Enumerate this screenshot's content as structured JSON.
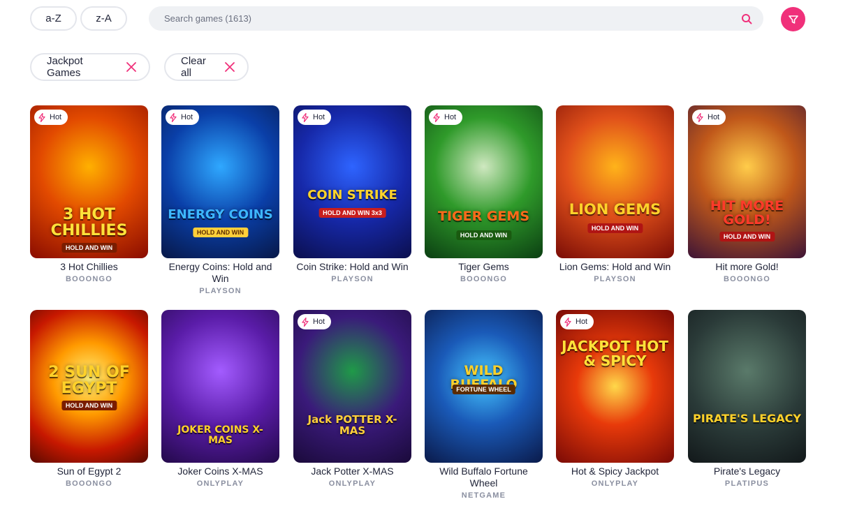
{
  "sort": {
    "az_label": "a-Z",
    "za_label": "z-A"
  },
  "search": {
    "placeholder": "Search games (1613)"
  },
  "filters": {
    "active_chip_label": "Jackpot Games",
    "clear_label": "Clear all"
  },
  "colors": {
    "accent": "#f0307a"
  },
  "hot_label": "Hot",
  "games": [
    {
      "name": "3 Hot Chillies",
      "provider": "BOOONGO",
      "hot": true,
      "art_title": "3 HOT CHILLIES",
      "art_sub": "HOLD AND WIN"
    },
    {
      "name": "Energy Coins: Hold and Win",
      "provider": "PLAYSON",
      "hot": true,
      "art_title": "ENERGY COINS",
      "art_sub": "HOLD AND WIN"
    },
    {
      "name": "Coin Strike: Hold and Win",
      "provider": "PLAYSON",
      "hot": true,
      "art_title": "COIN STRIKE",
      "art_sub": "HOLD AND WIN 3x3"
    },
    {
      "name": "Tiger Gems",
      "provider": "BOOONGO",
      "hot": true,
      "art_title": "TIGER GEMS",
      "art_sub": "HOLD AND WIN"
    },
    {
      "name": "Lion Gems: Hold and Win",
      "provider": "PLAYSON",
      "hot": false,
      "art_title": "LION GEMS",
      "art_sub": "HOLD AND WIN"
    },
    {
      "name": "Hit more Gold!",
      "provider": "BOOONGO",
      "hot": true,
      "art_title": "HIT MORE GOLD!",
      "art_sub": "HOLD AND WIN"
    },
    {
      "name": "Sun of Egypt 2",
      "provider": "BOOONGO",
      "hot": false,
      "art_title": "2 SUN OF EGYPT",
      "art_sub": "HOLD AND WIN"
    },
    {
      "name": "Joker Coins X-MAS",
      "provider": "ONLYPLAY",
      "hot": false,
      "art_title": "JOKER COINS X-MAS",
      "art_sub": ""
    },
    {
      "name": "Jack Potter X-MAS",
      "provider": "ONLYPLAY",
      "hot": true,
      "art_title": "Jack POTTER X-MAS",
      "art_sub": ""
    },
    {
      "name": "Wild Buffalo Fortune Wheel",
      "provider": "NETGAME",
      "hot": false,
      "art_title": "WILD BUFFALO",
      "art_sub": "FORTUNE WHEEL"
    },
    {
      "name": "Hot & Spicy Jackpot",
      "provider": "ONLYPLAY",
      "hot": true,
      "art_title": "JACKPOT HOT & SPICY",
      "art_sub": ""
    },
    {
      "name": "Pirate's Legacy",
      "provider": "PLATIPUS",
      "hot": false,
      "art_title": "PIRATE'S LEGACY",
      "art_sub": ""
    }
  ]
}
